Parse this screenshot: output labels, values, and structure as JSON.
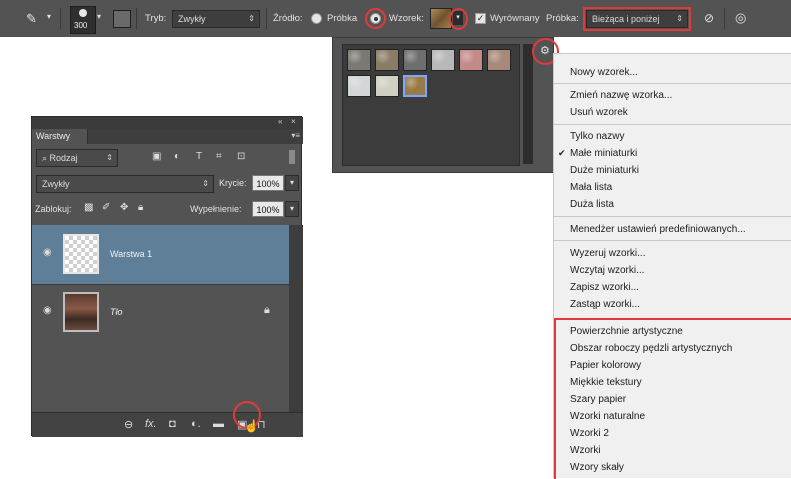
{
  "options_bar": {
    "brush_size": "300",
    "mode_label": "Tryb:",
    "mode_value": "Zwykły",
    "source_label": "Źródło:",
    "sample_option": "Próbka",
    "pattern_option": "Wzorek:",
    "aligned_label": "Wyrównany",
    "sample_label": "Próbka:",
    "sample_value": "Bieżąca i poniżej"
  },
  "pattern_picker": {
    "swatch_colors": [
      "#7a7a72",
      "#8a7d66",
      "#6e6e6e",
      "#b8b8b8",
      "#c48a8a",
      "#a88878",
      "#d2d6d6",
      "#cfcfc2",
      "#9a7b45"
    ],
    "selected_index": 8
  },
  "menu": {
    "group1": [
      "Nowy wzorek..."
    ],
    "group2": [
      "Zmień nazwę wzorka...",
      "Usuń wzorek"
    ],
    "group3": [
      "Tylko nazwy",
      "Małe miniaturki",
      "Duże miniaturki",
      "Mała lista",
      "Duża lista"
    ],
    "checked": "Małe miniaturki",
    "group4": [
      "Menedżer ustawień predefiniowanych..."
    ],
    "group5": [
      "Wyzeruj wzorki...",
      "Wczytaj wzorki...",
      "Zapisz wzorki...",
      "Zastąp wzorki..."
    ],
    "group6": [
      "Powierzchnie artystyczne",
      "Obszar roboczy pędzli artystycznych",
      "Papier kolorowy",
      "Miękkie tekstury",
      "Szary papier",
      "Wzorki naturalne",
      "Wzorki 2",
      "Wzorki",
      "Wzory skały"
    ]
  },
  "layers_panel": {
    "tab": "Warstwy",
    "filter_label": "Rodzaj",
    "blend_mode": "Zwykły",
    "opacity_label": "Krycie:",
    "opacity_value": "100%",
    "lock_label": "Zablokuj:",
    "fill_label": "Wypełnienie:",
    "fill_value": "100%",
    "layers": [
      {
        "name": "Warstwa 1",
        "selected": true
      },
      {
        "name": "Tło",
        "locked": true
      }
    ]
  }
}
